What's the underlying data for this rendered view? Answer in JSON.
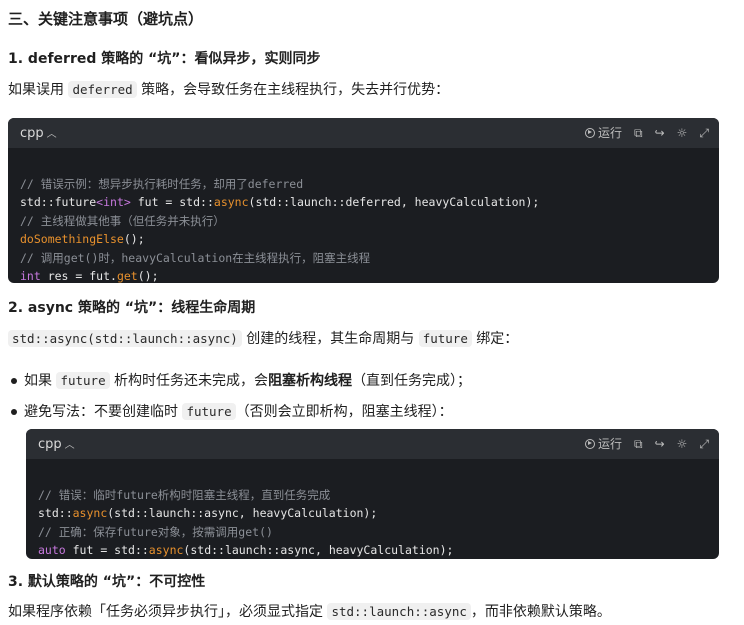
{
  "section_title": "三、关键注意事项（避坑点）",
  "s1": {
    "title": "1. deferred 策略的 “坑”：看似异步，实则同步",
    "para_pre": "如果误用 ",
    "para_code": "deferred",
    "para_post": " 策略，会导致任务在主线程执行，失去并行优势：",
    "code": {
      "lang": "cpp",
      "run_label": "运行",
      "lines": [
        "// 错误示例：想异步执行耗时任务，却用了deferred",
        "std::future<int> fut = std::async(std::launch::deferred, heavyCalculation);",
        "// 主线程做其他事（但任务并未执行）",
        "doSomethingElse();",
        "// 调用get()时，heavyCalculation在主线程执行，阻塞主线程",
        "int res = fut.get();"
      ]
    }
  },
  "s2": {
    "title": "2. async 策略的 “坑”：线程生命周期",
    "para_code": "std::async(std::launch::async)",
    "para_post": " 创建的线程，其生命周期与 ",
    "para_code2": "future",
    "para_post2": " 绑定：",
    "bullet1_pre": "如果 ",
    "bullet1_code": "future",
    "bullet1_mid": " 析构时任务还未完成，会",
    "bullet1_bold": "阻塞析构线程",
    "bullet1_post": "（直到任务完成）；",
    "bullet2_pre": "避免写法：不要创建临时 ",
    "bullet2_code": "future",
    "bullet2_post": "（否则会立即析构，阻塞主线程）：",
    "code": {
      "lang": "cpp",
      "run_label": "运行",
      "lines": [
        "// 错误：临时future析构时阻塞主线程，直到任务完成",
        "std::async(std::launch::async, heavyCalculation);",
        "// 正确：保存future对象，按需调用get()",
        "auto fut = std::async(std::launch::async, heavyCalculation);"
      ]
    }
  },
  "s3": {
    "title": "3. 默认策略的 “坑”：不可控性",
    "para_pre": "如果程序依赖「任务必须异步执行」，必须显式指定 ",
    "para_code": "std::launch::async",
    "para_post": "，而非依赖默认策略。"
  },
  "icons": [
    "caret-up-icon",
    "play-icon",
    "copy-icon",
    "share-icon",
    "theme-icon",
    "expand-icon"
  ]
}
